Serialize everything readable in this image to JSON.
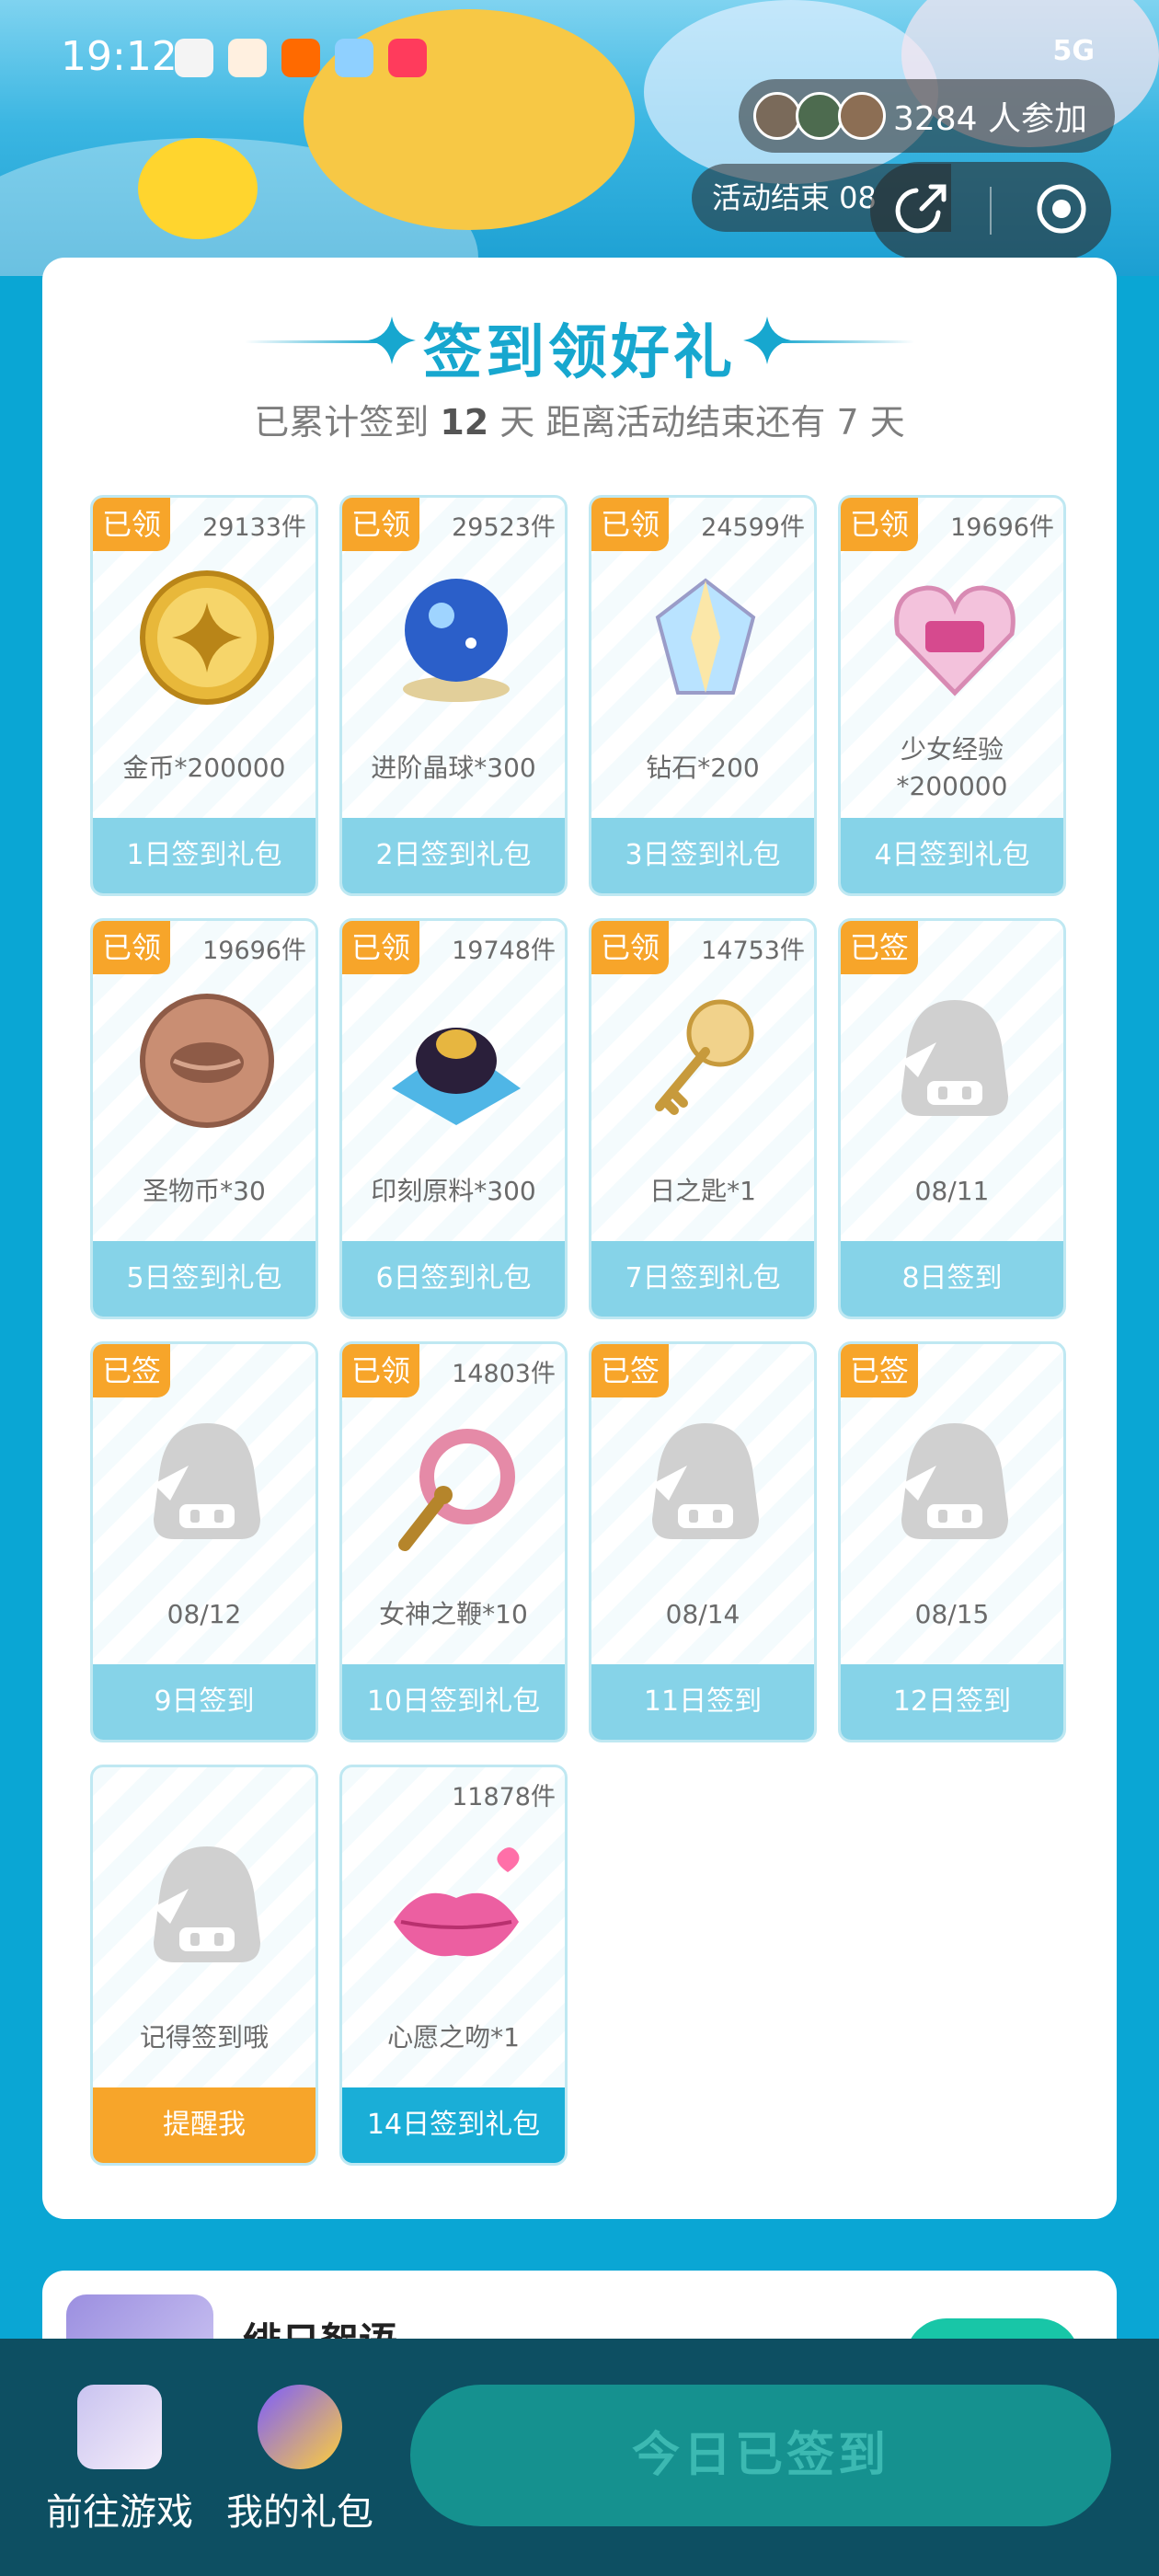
{
  "status_bar": {
    "time": "19:12",
    "network": "5G"
  },
  "header": {
    "participants": "3284 人参加",
    "activity_end": "活动结束 08",
    "share_icon": "share-icon",
    "close_icon": "target-icon"
  },
  "panel": {
    "title": "签到领好礼",
    "subtitle_pre": "已累计签到",
    "days_signed": "12",
    "subtitle_mid": "天  距离活动结束还有",
    "days_left": "7",
    "subtitle_post": "天"
  },
  "rewards": [
    {
      "tag": "已领",
      "count": "29133件",
      "name": "金币*200000",
      "button": "1日签到礼包",
      "icon": "gold-coin-icon"
    },
    {
      "tag": "已领",
      "count": "29523件",
      "name": "进阶晶球*300",
      "button": "2日签到礼包",
      "icon": "crystal-ball-icon"
    },
    {
      "tag": "已领",
      "count": "24599件",
      "name": "钻石*200",
      "button": "3日签到礼包",
      "icon": "diamond-icon"
    },
    {
      "tag": "已领",
      "count": "19696件",
      "name": "少女经验\n*200000",
      "button": "4日签到礼包",
      "icon": "experience-heart-icon"
    },
    {
      "tag": "已领",
      "count": "19696件",
      "name": "圣物币*30",
      "button": "5日签到礼包",
      "icon": "relic-coin-icon"
    },
    {
      "tag": "已领",
      "count": "19748件",
      "name": "印刻原料*300",
      "button": "6日签到礼包",
      "icon": "engraving-material-icon"
    },
    {
      "tag": "已领",
      "count": "14753件",
      "name": "日之匙*1",
      "button": "7日签到礼包",
      "icon": "sun-key-icon"
    },
    {
      "tag": "已签",
      "count": "",
      "name": "08/11",
      "button": "8日签到",
      "icon": "placeholder-avatar-icon"
    },
    {
      "tag": "已签",
      "count": "",
      "name": "08/12",
      "button": "9日签到",
      "icon": "placeholder-avatar-icon"
    },
    {
      "tag": "已领",
      "count": "14803件",
      "name": "女神之鞭*10",
      "button": "10日签到礼包",
      "icon": "goddess-whip-icon"
    },
    {
      "tag": "已签",
      "count": "",
      "name": "08/14",
      "button": "11日签到",
      "icon": "placeholder-avatar-icon"
    },
    {
      "tag": "已签",
      "count": "",
      "name": "08/15",
      "button": "12日签到",
      "icon": "placeholder-avatar-icon"
    },
    {
      "tag": "",
      "count": "",
      "name": "记得签到哦",
      "button": "提醒我",
      "icon": "placeholder-avatar-icon"
    },
    {
      "tag": "",
      "count": "11878件",
      "name": "心愿之吻*1",
      "button": "14日签到礼包",
      "icon": "wish-kiss-icon"
    }
  ],
  "next_game": {
    "title": "绯日絮语"
  },
  "bottom_nav": {
    "go_game": "前往游戏",
    "my_gifts": "我的礼包",
    "sign_button": "今日已签到"
  },
  "colors": {
    "accent": "#17a7cf",
    "tag_orange": "#f7a52a",
    "card_button": "#86d3e8",
    "background": "#0aa6d4"
  }
}
